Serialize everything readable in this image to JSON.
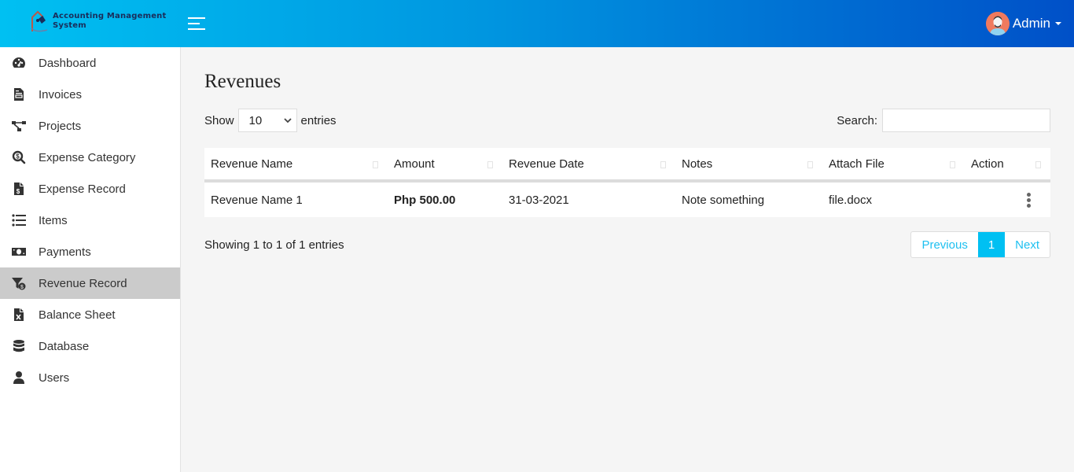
{
  "header": {
    "app_title_line1": "Accounting Management",
    "app_title_line2": "System",
    "user_name": "Admin"
  },
  "sidebar": {
    "items": [
      {
        "label": "Dashboard",
        "icon": "tachometer-icon"
      },
      {
        "label": "Invoices",
        "icon": "file-invoice-icon"
      },
      {
        "label": "Projects",
        "icon": "project-diagram-icon"
      },
      {
        "label": "Expense Category",
        "icon": "search-dollar-icon"
      },
      {
        "label": "Expense Record",
        "icon": "file-dollar-icon"
      },
      {
        "label": "Items",
        "icon": "list-icon"
      },
      {
        "label": "Payments",
        "icon": "money-bill-icon"
      },
      {
        "label": "Revenue Record",
        "icon": "funnel-dollar-icon",
        "active": true
      },
      {
        "label": "Balance Sheet",
        "icon": "file-excel-icon"
      },
      {
        "label": "Database",
        "icon": "database-icon"
      },
      {
        "label": "Users",
        "icon": "user-icon"
      }
    ]
  },
  "main": {
    "title": "Revenues",
    "length": {
      "show_label": "Show",
      "value": "10",
      "entries_label": "entries"
    },
    "search": {
      "label": "Search:",
      "value": "",
      "placeholder": ""
    },
    "table": {
      "columns": [
        "Revenue Name",
        "Amount",
        "Revenue Date",
        "Notes",
        "Attach File",
        "Action"
      ],
      "rows": [
        {
          "name": "Revenue Name 1",
          "amount": "Php 500.00",
          "date": "31-03-2021",
          "notes": "Note something",
          "file": "file.docx"
        }
      ]
    },
    "info": "Showing 1 to 1 of 1 entries",
    "pagination": {
      "previous": "Previous",
      "current": "1",
      "next": "Next"
    }
  },
  "colors": {
    "accent": "#00c0f2",
    "header_start": "#00c0f2",
    "header_end": "#0050c8",
    "active_nav": "#cbcbcb"
  }
}
